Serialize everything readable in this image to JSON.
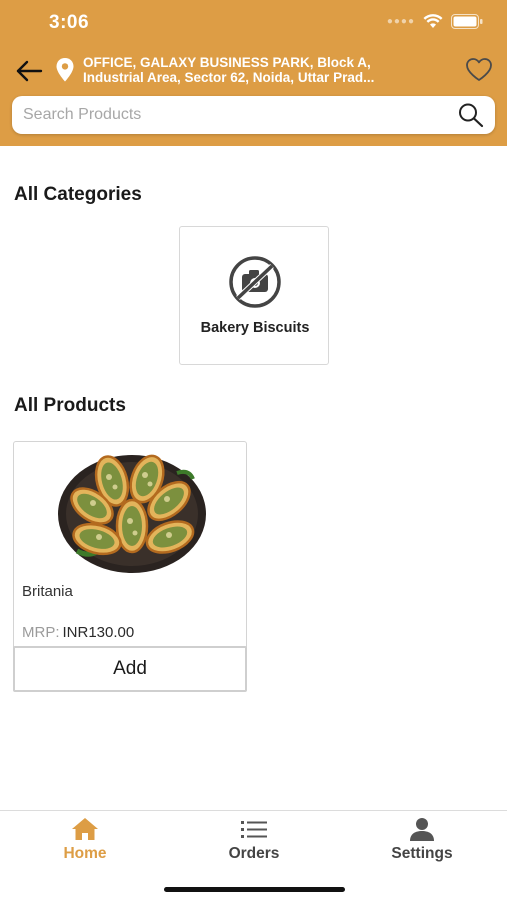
{
  "status_bar": {
    "time": "3:06",
    "icons": [
      "signal-icon",
      "wifi-icon",
      "battery-icon"
    ]
  },
  "header": {
    "address_line1": "OFFICE, GALAXY BUSINESS PARK, Block A,",
    "address_line2": "Industrial Area, Sector 62, Noida, Uttar Prad...",
    "icons": [
      "back-arrow-icon",
      "location-pin-icon",
      "heart-icon"
    ]
  },
  "search": {
    "placeholder": "Search Products",
    "value": ""
  },
  "categories_section": {
    "title": "All Categories",
    "items": [
      {
        "label": "Bakery Biscuits",
        "icon": "no-photo-icon"
      }
    ]
  },
  "products_section": {
    "title": "All Products",
    "items": [
      {
        "name": "Britania",
        "mrp_label": "MRP:",
        "price": "INR130.00",
        "add_label": "Add",
        "image": "garlic-bread-image"
      }
    ]
  },
  "bottom_nav": {
    "items": [
      {
        "label": "Home",
        "icon": "home-icon",
        "active": true
      },
      {
        "label": "Orders",
        "icon": "list-icon",
        "active": false
      },
      {
        "label": "Settings",
        "icon": "user-icon",
        "active": false
      }
    ]
  },
  "colors": {
    "accent": "#dd9d45",
    "nav_active": "#dd9d45",
    "nav_inactive": "#555555"
  }
}
